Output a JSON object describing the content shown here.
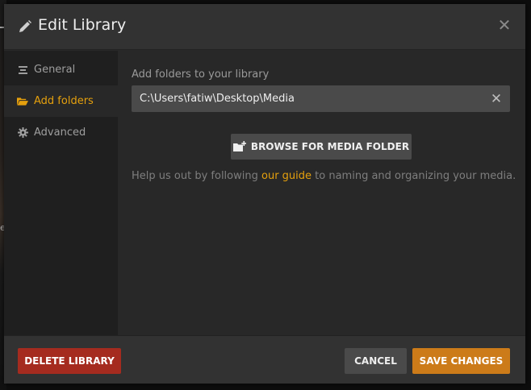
{
  "background": {
    "edge_text": "e"
  },
  "modal": {
    "title": "Edit Library",
    "close_icon": "close-icon"
  },
  "sidebar": {
    "items": [
      {
        "label": "General",
        "icon": "list-lines-icon",
        "active": false
      },
      {
        "label": "Add folders",
        "icon": "folder-open-icon",
        "active": true
      },
      {
        "label": "Advanced",
        "icon": "gear-icon",
        "active": false
      }
    ]
  },
  "content": {
    "field_label": "Add folders to your library",
    "path_value": "C:\\Users\\fatiw\\Desktop\\Media",
    "browse_label": "BROWSE FOR MEDIA FOLDER",
    "help_prefix": "Help us out by following ",
    "help_link": "our guide",
    "help_suffix": " to naming and organizing your media."
  },
  "footer": {
    "delete_label": "DELETE LIBRARY",
    "cancel_label": "CANCEL",
    "save_label": "SAVE CHANGES"
  },
  "colors": {
    "accent": "#e5a00d",
    "danger": "#a52b1f",
    "save": "#cc7b19"
  }
}
